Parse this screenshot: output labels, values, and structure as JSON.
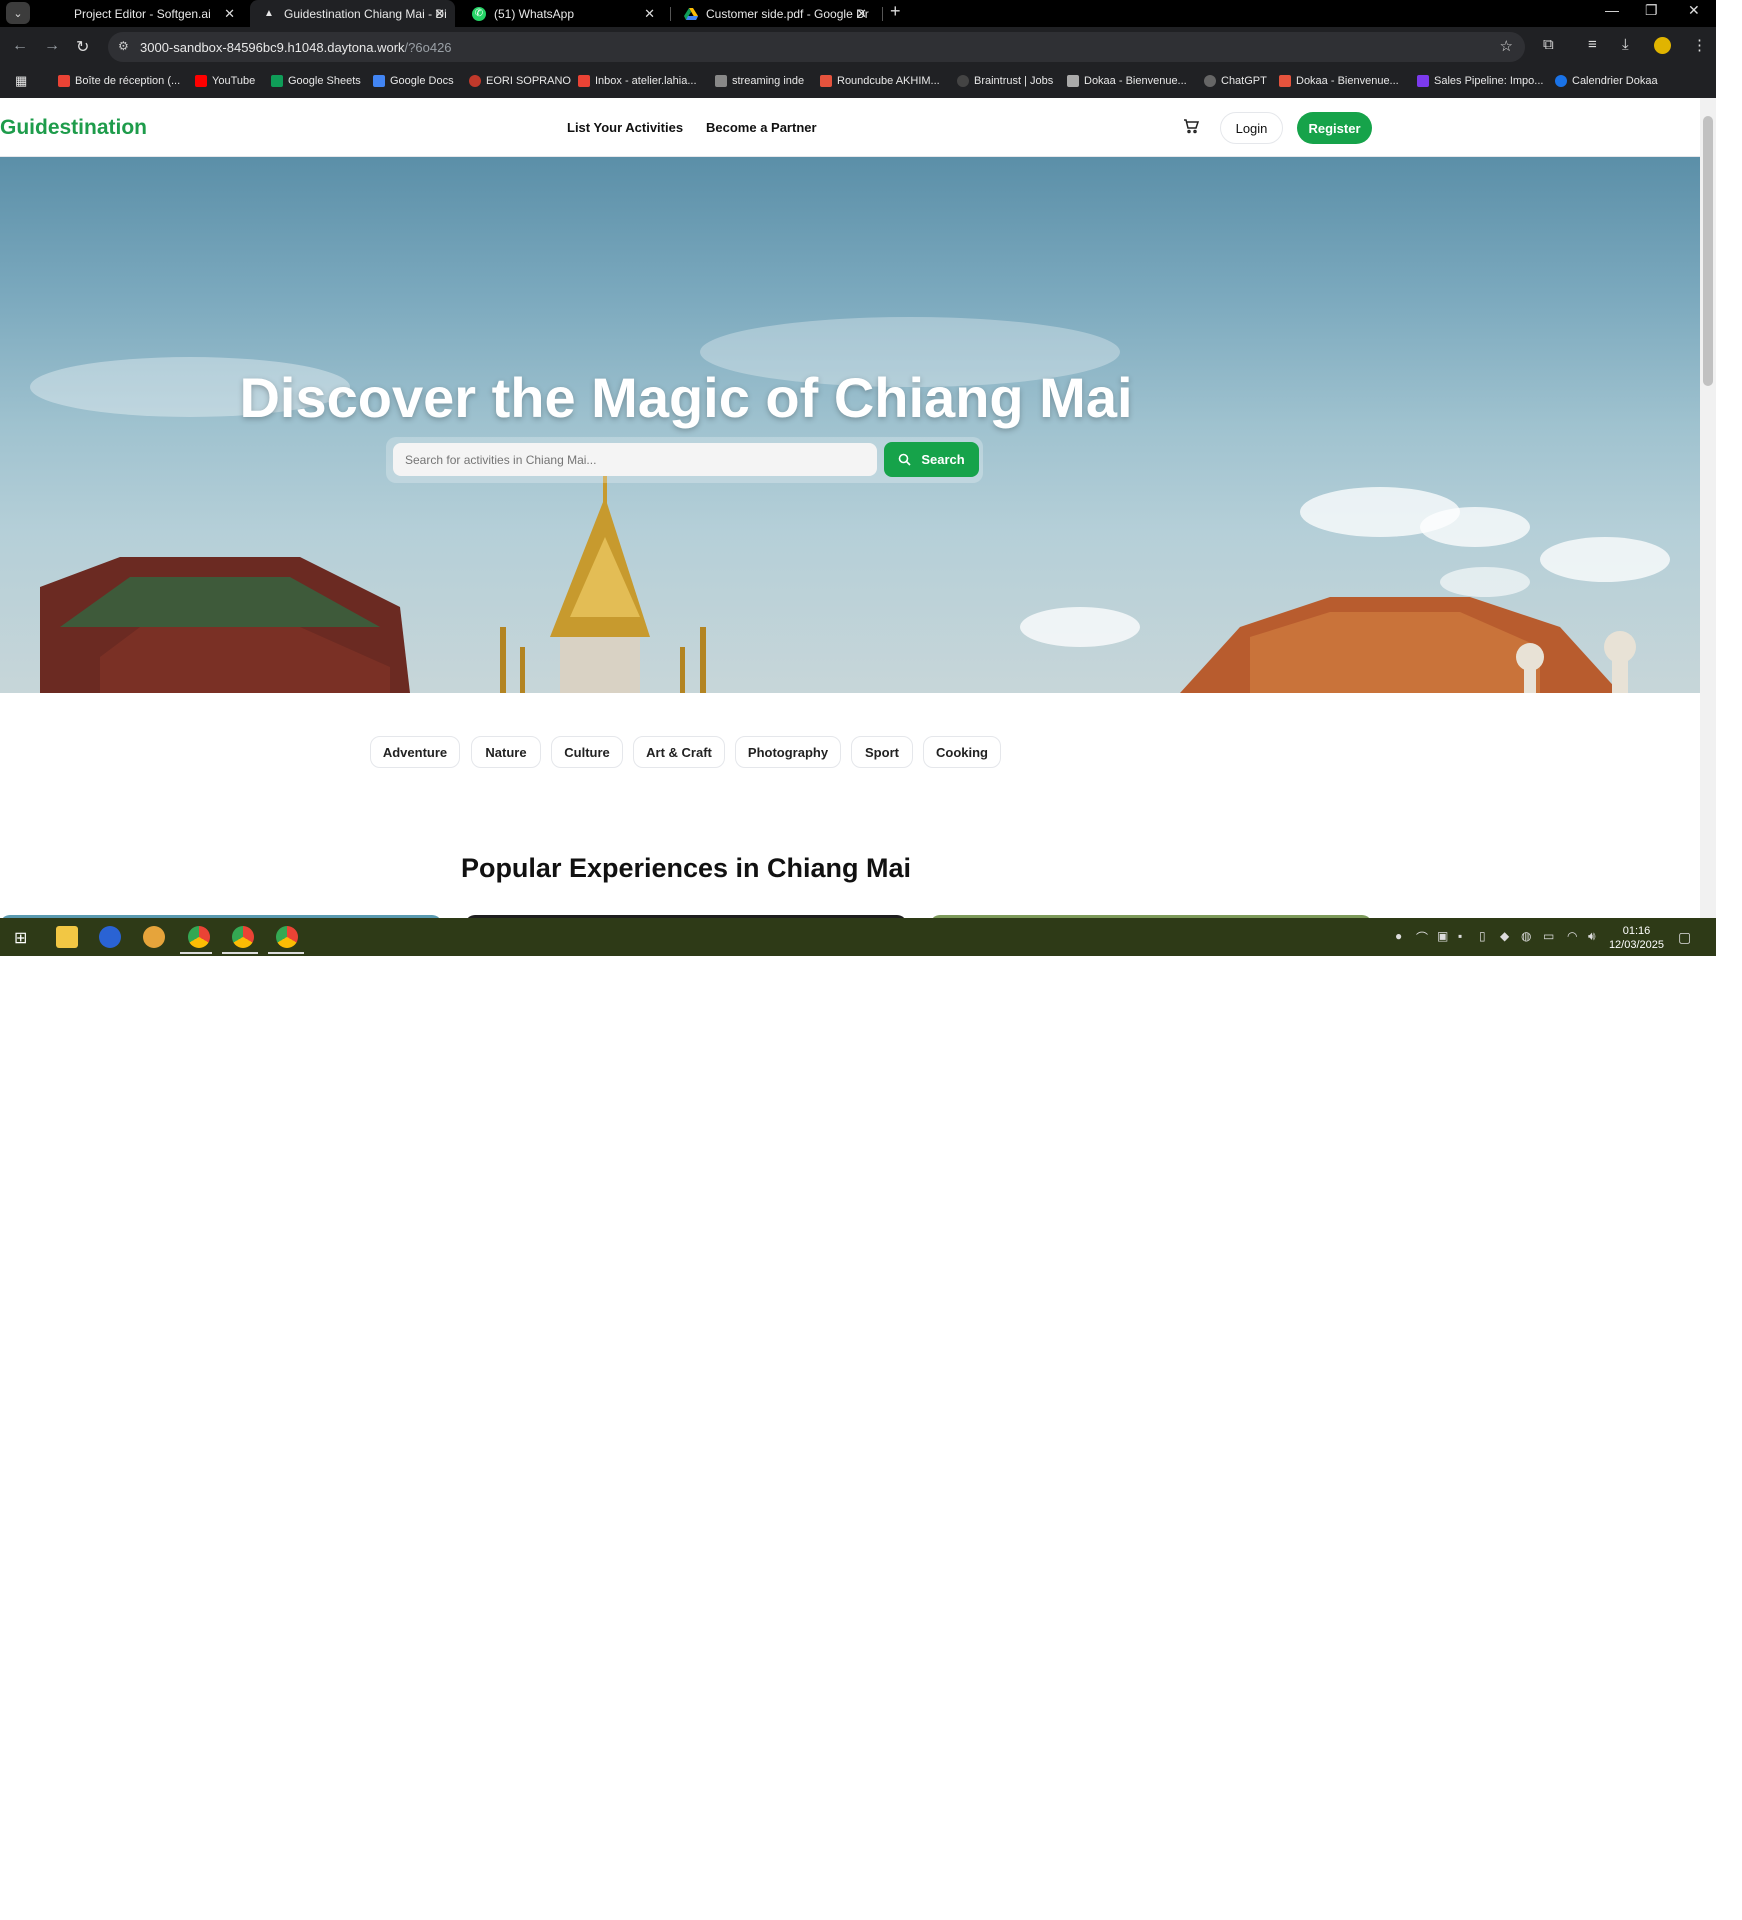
{
  "browser": {
    "tabs": [
      {
        "title": "Project Editor - Softgen.ai",
        "active": false
      },
      {
        "title": "Guidestination Chiang Mai - Di",
        "active": true
      },
      {
        "title": "(51) WhatsApp",
        "active": false
      },
      {
        "title": "Customer side.pdf - Google Dr",
        "active": false
      }
    ],
    "url_host": "3000-sandbox-84596bc9.h1048.daytona.work",
    "url_path": "/?6o426",
    "bookmarks": [
      "Boîte de réception (...",
      "YouTube",
      "Google Sheets",
      "Google Docs",
      "EORI SOPRANO",
      "Inbox - atelier.lahia...",
      "streaming inde",
      "Roundcube AKHIM...",
      "Braintrust | Jobs",
      "Dokaa - Bienvenue...",
      "ChatGPT",
      "Dokaa - Bienvenue...",
      "Sales Pipeline: Impo...",
      "Calendrier Dokaa"
    ]
  },
  "site": {
    "logo": "Guidestination",
    "nav": {
      "list_activities": "List Your Activities",
      "become_partner": "Become a Partner"
    },
    "login": "Login",
    "register": "Register",
    "hero_title": "Discover the Magic of Chiang Mai",
    "search_placeholder": "Search for activities in Chiang Mai...",
    "search_button": "Search",
    "categories": [
      "Adventure",
      "Nature",
      "Culture",
      "Art & Craft",
      "Photography",
      "Sport",
      "Cooking"
    ],
    "popular_title": "Popular Experiences in Chiang Mai"
  },
  "taskbar": {
    "time": "01:16",
    "date": "12/03/2025"
  },
  "colors": {
    "brand": "#16a34a",
    "logo": "#1e9c4b"
  }
}
